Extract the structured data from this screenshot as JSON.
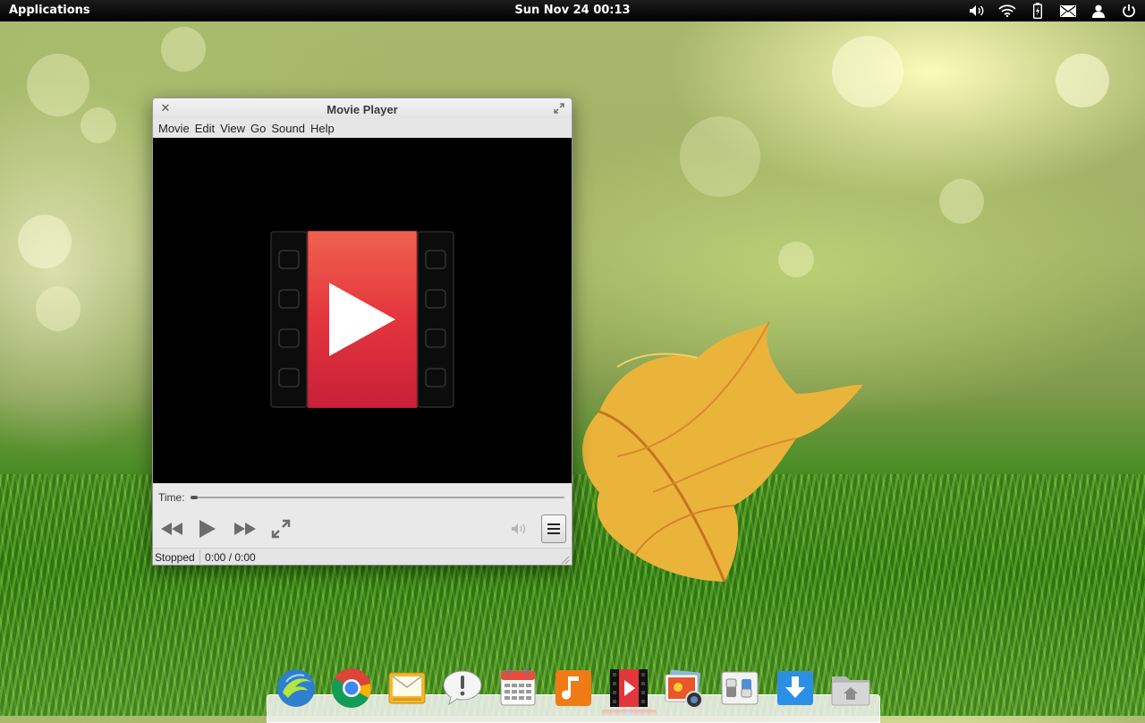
{
  "panel": {
    "applications_label": "Applications",
    "clock": "Sun Nov 24 00:13",
    "indicators": [
      "volume-icon",
      "wifi-icon",
      "battery-icon",
      "mail-icon",
      "user-icon",
      "power-icon"
    ]
  },
  "window": {
    "title": "Movie Player",
    "menu": [
      "Movie",
      "Edit",
      "View",
      "Go",
      "Sound",
      "Help"
    ],
    "time_label": "Time:",
    "seek_position": 0,
    "status": "Stopped",
    "time_display": "0:00 / 0:00",
    "controls": [
      "rewind-icon",
      "play-icon",
      "fast-forward-icon",
      "fullscreen-icon",
      "volume-icon",
      "menu-icon"
    ]
  },
  "dock": {
    "items": [
      "midori-browser-icon",
      "chrome-browser-icon",
      "mail-app-icon",
      "notifications-app-icon",
      "calendar-app-icon",
      "music-app-icon",
      "movie-player-app-icon",
      "photos-app-icon",
      "system-settings-icon",
      "downloads-folder-icon",
      "home-folder-icon"
    ],
    "running_app": "movie-player-app-icon"
  },
  "colors": {
    "panel_bg": "#000000",
    "player_red": "#e3353c",
    "window_bg": "#e9e9e9"
  }
}
